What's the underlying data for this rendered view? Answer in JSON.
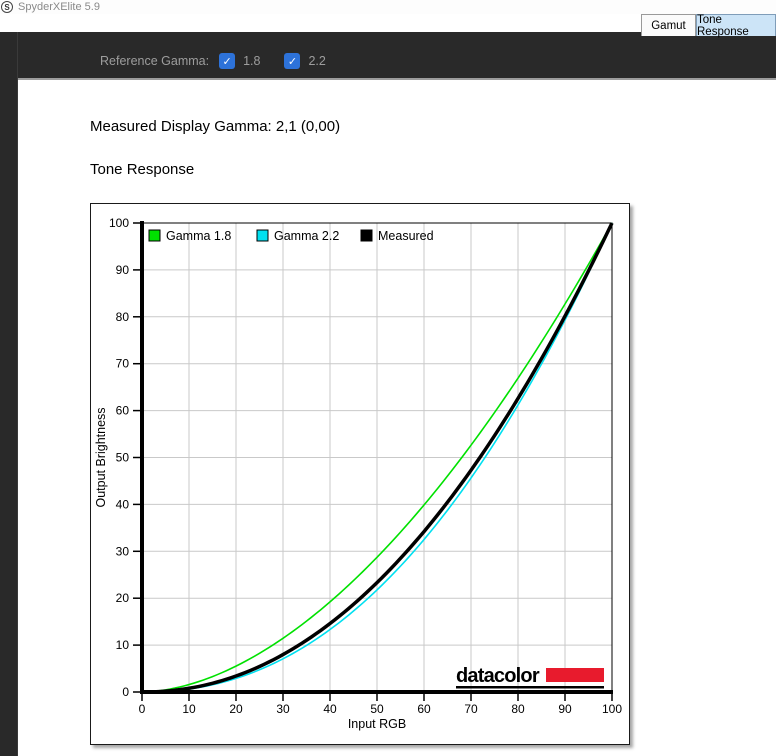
{
  "window": {
    "title": "SpyderXElite 5.9",
    "icon": "S"
  },
  "tabs": [
    {
      "label": "Gamut",
      "active": false
    },
    {
      "label": "Tone Response",
      "active": true
    }
  ],
  "header": {
    "label": "Reference Gamma:",
    "checkboxes": [
      {
        "label": "1.8",
        "checked": true,
        "check_glyph": "✓"
      },
      {
        "label": "2.2",
        "checked": true,
        "check_glyph": "✓"
      }
    ],
    "checkbox_color": "#2d72d9"
  },
  "main": {
    "measured_gamma": "Measured Display Gamma: 2,1 (0,00)",
    "section_title": "Tone Response"
  },
  "chart_data": {
    "type": "line",
    "title": "",
    "xlabel": "Input RGB",
    "ylabel": "Output Brightness",
    "xlim": [
      0,
      100
    ],
    "ylim": [
      0,
      100
    ],
    "xticks": [
      0,
      10,
      20,
      30,
      40,
      50,
      60,
      70,
      80,
      90,
      100
    ],
    "yticks": [
      0,
      10,
      20,
      30,
      40,
      50,
      60,
      70,
      80,
      90,
      100
    ],
    "grid": true,
    "grid_color": "#c9c9c9",
    "legend_position": "top-inside",
    "x": [
      0,
      10,
      20,
      30,
      40,
      50,
      60,
      70,
      80,
      90,
      100
    ],
    "series": [
      {
        "name": "Gamma 1.8",
        "color": "#00e100",
        "gamma": 1.8,
        "width": 1.6,
        "values": [
          0,
          1.6,
          5.5,
          11.5,
          19.2,
          28.7,
          39.9,
          52.6,
          66.9,
          82.7,
          100
        ]
      },
      {
        "name": "Gamma 2.2",
        "color": "#00e0f0",
        "gamma": 2.2,
        "width": 1.6,
        "values": [
          0,
          0.6,
          2.9,
          7.1,
          13.3,
          21.8,
          32.5,
          45.6,
          61.2,
          79.3,
          100
        ]
      },
      {
        "name": "Measured",
        "color": "#000000",
        "gamma": 2.1,
        "width": 3.5,
        "values": [
          0,
          0.8,
          3.4,
          8.0,
          14.6,
          23.3,
          34.2,
          47.2,
          62.6,
          80.2,
          100
        ]
      }
    ],
    "branding": {
      "text": "datacolor",
      "bar_color": "#e81b2d",
      "text_color": "#000000"
    }
  }
}
